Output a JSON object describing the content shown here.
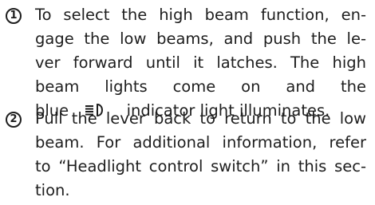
{
  "steps": [
    {
      "number": "1",
      "lines": [
        "To select the high beam function, en-",
        "gage the low beams, and push the le-",
        "ver forward until it latches. The high",
        "beam lights come on and the"
      ],
      "last_line_before_icon": "blue",
      "icon": "high-beam-indicator-icon",
      "last_line_after_icon": "indicator light illuminates."
    },
    {
      "number": "2",
      "lines": [
        "Pull the lever back to return to the low",
        "beam. For additional information, refer",
        "to “Headlight control switch” in this sec-",
        "tion."
      ]
    }
  ]
}
